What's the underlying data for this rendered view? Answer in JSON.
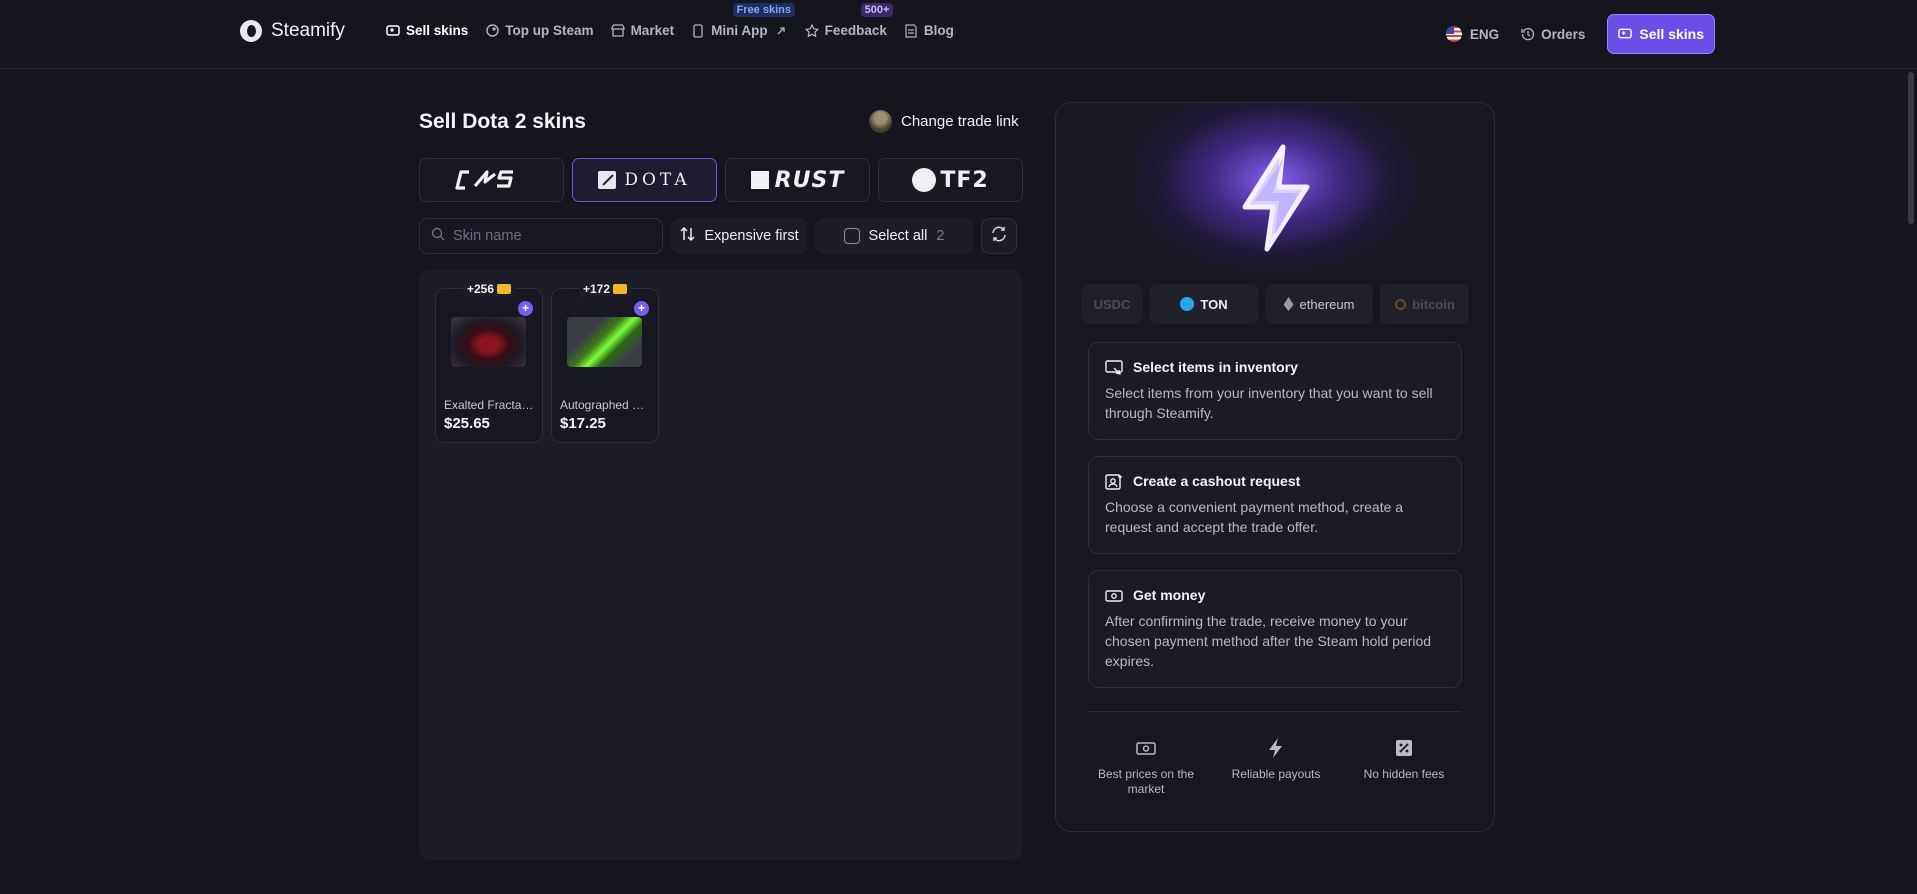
{
  "header": {
    "brand": "Steamify",
    "nav": [
      {
        "label": "Sell skins",
        "icon": "sell-icon",
        "active": true
      },
      {
        "label": "Top up Steam",
        "icon": "steam-icon"
      },
      {
        "label": "Market",
        "icon": "shop-icon",
        "badge": "Free skins"
      },
      {
        "label": "Mini App",
        "icon": "phone-icon",
        "suffix_icon": "external-link-icon"
      },
      {
        "label": "Feedback",
        "icon": "star-icon",
        "badge": "500+"
      },
      {
        "label": "Blog",
        "icon": "blog-icon"
      }
    ],
    "language": "ENG",
    "orders_label": "Orders",
    "sell_button": "Sell skins"
  },
  "main": {
    "title": "Sell Dota 2 skins",
    "trade_link_label": "Change trade link",
    "games": [
      "CS",
      "DOTA",
      "RUST",
      "TF2"
    ],
    "active_game": "DOTA",
    "search_placeholder": "Skin name",
    "sort_label": "Expensive first",
    "select_all_label": "Select all",
    "select_all_count": "2",
    "items": [
      {
        "bonus": "+256",
        "name": "Exalted Fractal Horns of Inner Abysm",
        "price": "$25.65"
      },
      {
        "bonus": "+172",
        "name": "Autographed Eldwurm's Touch",
        "price": "$17.25"
      }
    ]
  },
  "info": {
    "payment_methods": [
      "USDC",
      "TON",
      "ethereum",
      "bitcoin"
    ],
    "steps": [
      {
        "title": "Select items in inventory",
        "desc": "Select items from your inventory that you want to sell through Steamify."
      },
      {
        "title": "Create a cashout request",
        "desc": "Choose a convenient payment method, create a request and accept the trade offer."
      },
      {
        "title": "Get money",
        "desc": "After confirming the trade, receive money to your chosen payment method after the Steam hold period expires."
      }
    ],
    "features": [
      "Best prices on the market",
      "Reliable payouts",
      "No hidden fees"
    ]
  },
  "colors": {
    "accent": "#6b4ee6",
    "background": "#15151e",
    "card": "#1d1d28"
  }
}
